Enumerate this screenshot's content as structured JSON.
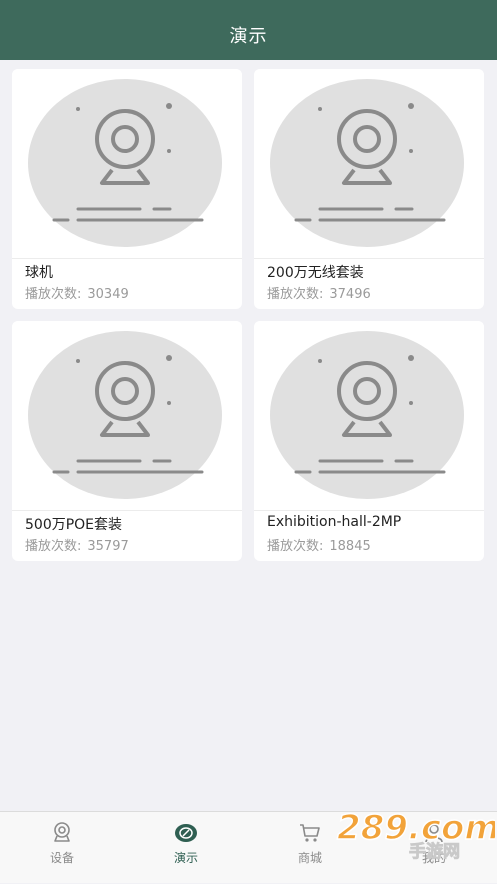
{
  "header": {
    "title": "演示"
  },
  "devices": [
    {
      "name": "球机",
      "plays_label": "播放次数:",
      "plays": "30349"
    },
    {
      "name": "200万无线套装",
      "plays_label": "播放次数:",
      "plays": "37496"
    },
    {
      "name": "500万POE套装",
      "plays_label": "播放次数:",
      "plays": "35797"
    },
    {
      "name": "Exhibition-hall-2MP",
      "plays_label": "播放次数:",
      "plays": "18845"
    }
  ],
  "tabbar": {
    "tabs": [
      {
        "label": "设备",
        "icon": "camera-icon",
        "active": false
      },
      {
        "label": "演示",
        "icon": "play-icon",
        "active": true
      },
      {
        "label": "商城",
        "icon": "cart-icon",
        "active": false
      },
      {
        "label": "我的",
        "icon": "user-icon",
        "active": false
      }
    ]
  },
  "watermark": {
    "text": "289.com",
    "sub": "手游网"
  },
  "colors": {
    "header": "#3e6a5c",
    "accent": "#2f5f52",
    "background": "#f1f1f5"
  }
}
